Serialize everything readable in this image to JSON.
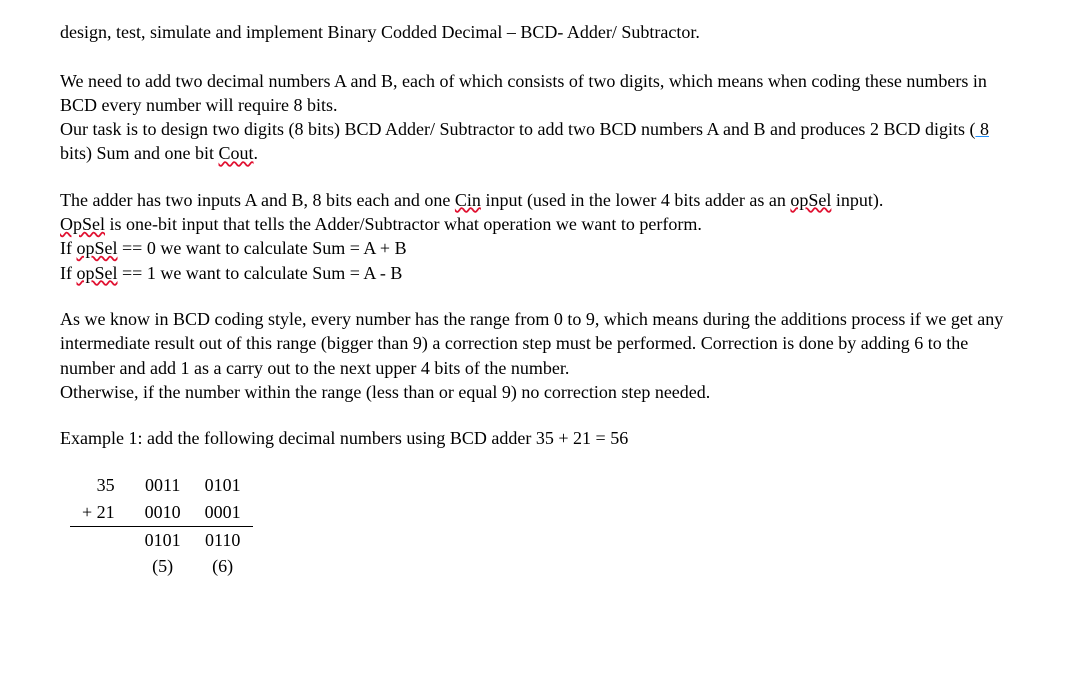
{
  "title_line": {
    "t1": "design",
    "t2": ", test, simulate and implement Binary Codded Decimal – BCD- Adder/ Subtractor."
  },
  "para1": {
    "p1": "We need to add two decimal numbers A and B, each of which consists of two digits, which means when coding these numbers in BCD every number will require 8 bits.",
    "p2a": "Our task is to design two digits (8 bits) BCD Adder/ Subtractor to add two BCD numbers A and B and produces 2 BCD digits (",
    "p2b": " 8",
    "p2c": " bits) Sum and one bit ",
    "p2d": "Cout",
    "p2e": "."
  },
  "para2": {
    "l1a": "The adder has two inputs A and B, 8 bits each and one ",
    "l1b": "Cin",
    "l1c": " input (used in the lower 4 bits adder as an ",
    "l1d": "opSel",
    "l1e": " input).",
    "l2a": "OpSel",
    "l2b": " is one-bit input that tells the Adder/Subtractor what operation we want to perform.",
    "l3a": "If ",
    "l3b": "opSel",
    "l3c": " == 0 we want to calculate Sum = A + B",
    "l4a": "If ",
    "l4b": "opSel",
    "l4c": " == 1 we want to calculate Sum = A - B"
  },
  "para3": {
    "p1": "As we know in BCD coding style,  every number has the range from 0 to 9, which means during the additions process if we get any intermediate result out of this range  (bigger than 9) a correction step must be performed. Correction is done by adding 6 to the number and add 1 as a carry out to the next upper 4 bits of the number.",
    "p2": "Otherwise, if the number within the range (less than or equal 9) no correction step needed."
  },
  "example_label": "Example 1: add the following decimal numbers using BCD adder 35 + 21 = 56",
  "calc": {
    "r1c1": "35",
    "r1c2": "0011",
    "r1c3": "0101",
    "r2c1": "+ 21",
    "r2c2": "0010",
    "r2c3": "0001",
    "r3c1": "",
    "r3c2": "0101",
    "r3c3": "0110",
    "r4c1": "",
    "r4c2": "(5)",
    "r4c3": "(6)"
  }
}
